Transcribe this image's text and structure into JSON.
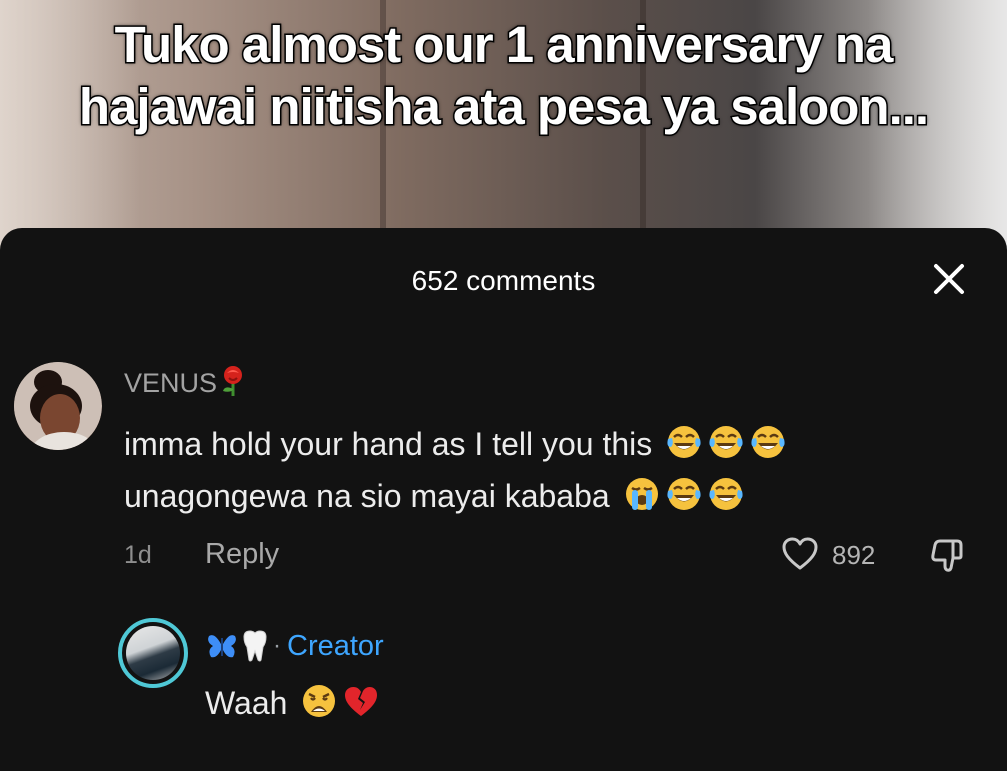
{
  "video": {
    "caption": "Tuko almost our 1 anniversary na hajawai niitisha ata pesa ya saloon..."
  },
  "comments_panel": {
    "title": "652 comments",
    "close_icon": "close-icon"
  },
  "comment": {
    "username": "VENUS",
    "username_emoji": "rose",
    "line1": "imma hold your hand as I tell you this",
    "line1_emojis": [
      "face-with-tears-of-joy",
      "face-with-tears-of-joy",
      "face-with-tears-of-joy"
    ],
    "line2": "unagongewa na sio mayai kababa",
    "line2_emojis": [
      "loudly-crying-face",
      "face-with-tears-of-joy",
      "face-with-tears-of-joy"
    ],
    "time": "1d",
    "reply_label": "Reply",
    "like_count": "892",
    "like_icon": "heart-icon",
    "dislike_icon": "thumbs-down-icon"
  },
  "reply": {
    "username_emojis": [
      "butterfly",
      "tooth"
    ],
    "separator": "·",
    "creator_label": "Creator",
    "text": "Waah",
    "text_emojis": [
      "weary-face",
      "broken-heart"
    ],
    "accent_color": "#3ea6ff",
    "avatar_ring_color": "#4fc8d6"
  },
  "colors": {
    "sheet_background": "#121212",
    "primary_text": "#ececec",
    "secondary_text": "#a3a3a3"
  }
}
